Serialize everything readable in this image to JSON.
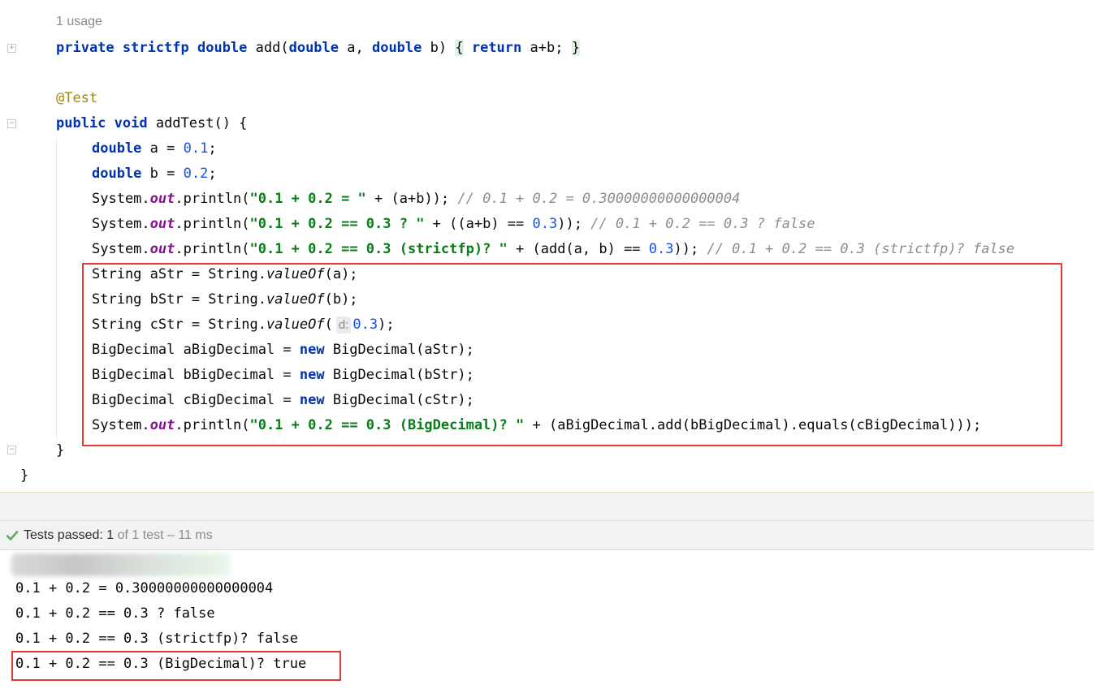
{
  "editor": {
    "usage_hint": "1 usage",
    "line_add_method": {
      "kw1": "private strictfp double ",
      "name": "add(",
      "kw2": "double ",
      "p1": "a, ",
      "kw3": "double ",
      "p2": "b) ",
      "open_brace": "{",
      "sp1": " ",
      "kw4": "return",
      "body": " a+b; ",
      "close_brace": "}"
    },
    "annotation": "@Test",
    "method_decl": {
      "kw": "public void ",
      "rest": "addTest() {"
    },
    "decl_a": {
      "kw": "double ",
      "mid": "a = ",
      "num": "0.1",
      "end": ";"
    },
    "decl_b": {
      "kw": "double ",
      "mid": "b = ",
      "num": "0.2",
      "end": ";"
    },
    "println1": {
      "recv": "System.",
      "out": "out",
      "call": ".println(",
      "str": "\"0.1 + 0.2 = \"",
      "rest": " + (a+b)); ",
      "comment": "// 0.1 + 0.2 = 0.30000000000000004"
    },
    "println2": {
      "recv": "System.",
      "out": "out",
      "call": ".println(",
      "str": "\"0.1 + 0.2 == 0.3 ? \"",
      "mid": " + ((a+b) == ",
      "num": "0.3",
      "end": ")); ",
      "comment": "// 0.1 + 0.2 == 0.3 ? false"
    },
    "println3": {
      "recv": "System.",
      "out": "out",
      "call": ".println(",
      "str": "\"0.1 + 0.2 == 0.3 (strictfp)? \"",
      "mid": " + (add(a, b) == ",
      "num": "0.3",
      "end": ")); ",
      "comment": "// 0.1 + 0.2 == 0.3 (strictfp)? false"
    },
    "astr": {
      "pre": "String aStr = String.",
      "method": "valueOf",
      "post": "(a);"
    },
    "bstr": {
      "pre": "String bStr = String.",
      "method": "valueOf",
      "post": "(b);"
    },
    "cstr": {
      "pre": "String cStr = String.",
      "method": "valueOf",
      "open": "(",
      "param_hint": "d:",
      "num": "0.3",
      "post": ");"
    },
    "big_a": {
      "pre": "BigDecimal aBigDecimal = ",
      "kw": "new",
      "post": " BigDecimal(aStr);"
    },
    "big_b": {
      "pre": "BigDecimal bBigDecimal = ",
      "kw": "new",
      "post": " BigDecimal(bStr);"
    },
    "big_c": {
      "pre": "BigDecimal cBigDecimal = ",
      "kw": "new",
      "post": " BigDecimal(cStr);"
    },
    "println4": {
      "recv": "System.",
      "out": "out",
      "call": ".println(",
      "str": "\"0.1 + 0.2 == 0.3 (BigDecimal)? \"",
      "rest": " + (aBigDecimal.add(bBigDecimal).equals(cBigDecimal)));"
    },
    "method_close": "}",
    "class_close": "}"
  },
  "test_status": {
    "icon": "check-icon",
    "label": "Tests passed: ",
    "passed": "1",
    "detail": " of 1 test – 11 ms"
  },
  "console": {
    "lines": [
      "0.1 + 0.2 = 0.30000000000000004",
      "0.1 + 0.2 == 0.3 ? false",
      "0.1 + 0.2 == 0.3 (strictfp)? false",
      "0.1 + 0.2 == 0.3 (BigDecimal)? true"
    ]
  },
  "colors": {
    "keyword": "#0033b3",
    "string": "#067d17",
    "number": "#1750eb",
    "comment": "#8c8c8c",
    "annotation": "#9e880d",
    "highlight_box": "#e53935",
    "pass_check": "#59a869"
  }
}
